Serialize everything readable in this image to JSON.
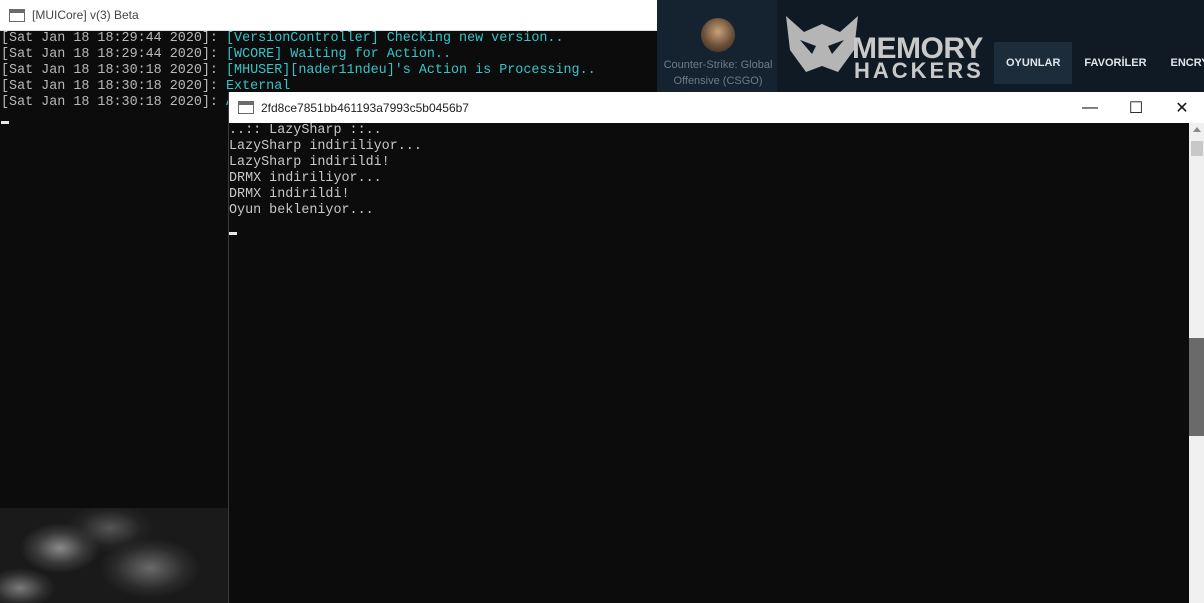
{
  "background_console": {
    "title": "[MUICore] v(3) Beta",
    "lines": [
      {
        "ts": "[Sat Jan 18 18:29:44 2020]: ",
        "msg": "[VersionController] Checking new version.."
      },
      {
        "ts": "[Sat Jan 18 18:29:44 2020]: ",
        "msg": "[WCORE] Waiting for Action.."
      },
      {
        "ts": "[Sat Jan 18 18:30:18 2020]: ",
        "msg": "[MHUSER][nader11ndeu]'s Action is Processing.."
      },
      {
        "ts": "[Sat Jan 18 18:30:18 2020]: ",
        "msg": "External"
      },
      {
        "ts": "[Sat Jan 18 18:30:18 2020]: ",
        "msg": "A"
      }
    ]
  },
  "website": {
    "game_title": "Counter-Strike: Global Offensive (CSGO)",
    "logo_line1": "MEMORY",
    "logo_line2": "HACKERS",
    "nav": [
      "OYUNLAR",
      "FAVORİLER",
      "ENCRYP"
    ]
  },
  "foreground_console": {
    "title": "2fd8ce7851bb461193a7993c5b0456b7",
    "lines": [
      "..:: LazySharp ::..",
      "LazySharp indiriliyor...",
      "LazySharp indirildi!",
      "DRMX indiriliyor...",
      "DRMX indirildi!",
      "Oyun bekleniyor..."
    ],
    "buttons": {
      "minimize": "—",
      "maximize": "☐",
      "close": "✕"
    }
  },
  "colors": {
    "console_bg": "#0c0c0c",
    "timestamp": "#b8b8b8",
    "message_cyan": "#36c4c8",
    "web_bg": "#0f1a24"
  }
}
